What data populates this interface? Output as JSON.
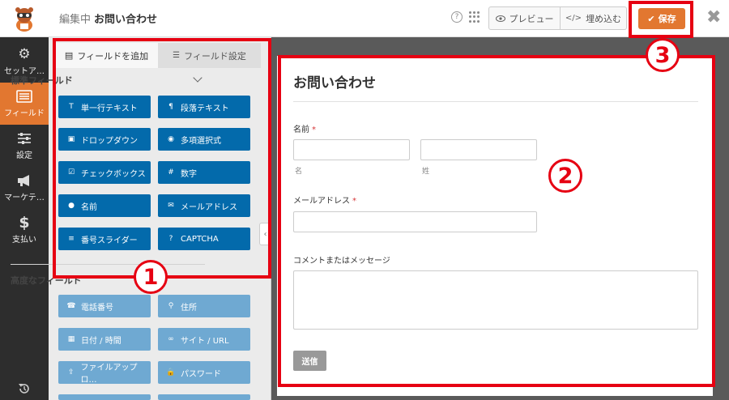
{
  "header": {
    "editing_label": "編集中",
    "form_title": "お問い合わせ",
    "help_glyph": "?",
    "preview_label": "プレビュー",
    "embed_label": "埋め込む",
    "save_label": "保存"
  },
  "sidebar": {
    "items": [
      {
        "label": "セットア…",
        "icon": "gear-icon"
      },
      {
        "label": "フィールド",
        "icon": "fields-icon",
        "active": true
      },
      {
        "label": "設定",
        "icon": "sliders-icon"
      },
      {
        "label": "マーケテ…",
        "icon": "megaphone-icon"
      },
      {
        "label": "支払い",
        "icon": "dollar-icon"
      }
    ]
  },
  "panel": {
    "tabs": [
      {
        "label": "フィールドを追加",
        "active": true
      },
      {
        "label": "フィールド設定",
        "active": false
      }
    ],
    "standard_title": "標準フィールド",
    "standard_fields": [
      "単一行テキスト",
      "段落テキスト",
      "ドロップダウン",
      "多項選択式",
      "チェックボックス",
      "数字",
      "名前",
      "メールアドレス",
      "番号スライダー",
      "CAPTCHA"
    ],
    "fancy_title": "高度なフィールド",
    "fancy_fields": [
      "電話番号",
      "住所",
      "日付 / 時間",
      "サイト / URL",
      "ファイルアップロ…",
      "パスワード"
    ]
  },
  "form": {
    "title": "お問い合わせ",
    "name_label": "名前",
    "required_mark": "*",
    "first_sub": "名",
    "last_sub": "姓",
    "email_label": "メールアドレス",
    "comment_label": "コメントまたはメッセージ",
    "submit_label": "送信"
  },
  "annotations": {
    "one": "1",
    "two": "2",
    "three": "3"
  },
  "colors": {
    "accent": "#e27730",
    "field_button": "#036aab",
    "field_button_light": "#6fa9d2",
    "annotation": "#e60012",
    "nav_bg": "#2d2d2d"
  }
}
